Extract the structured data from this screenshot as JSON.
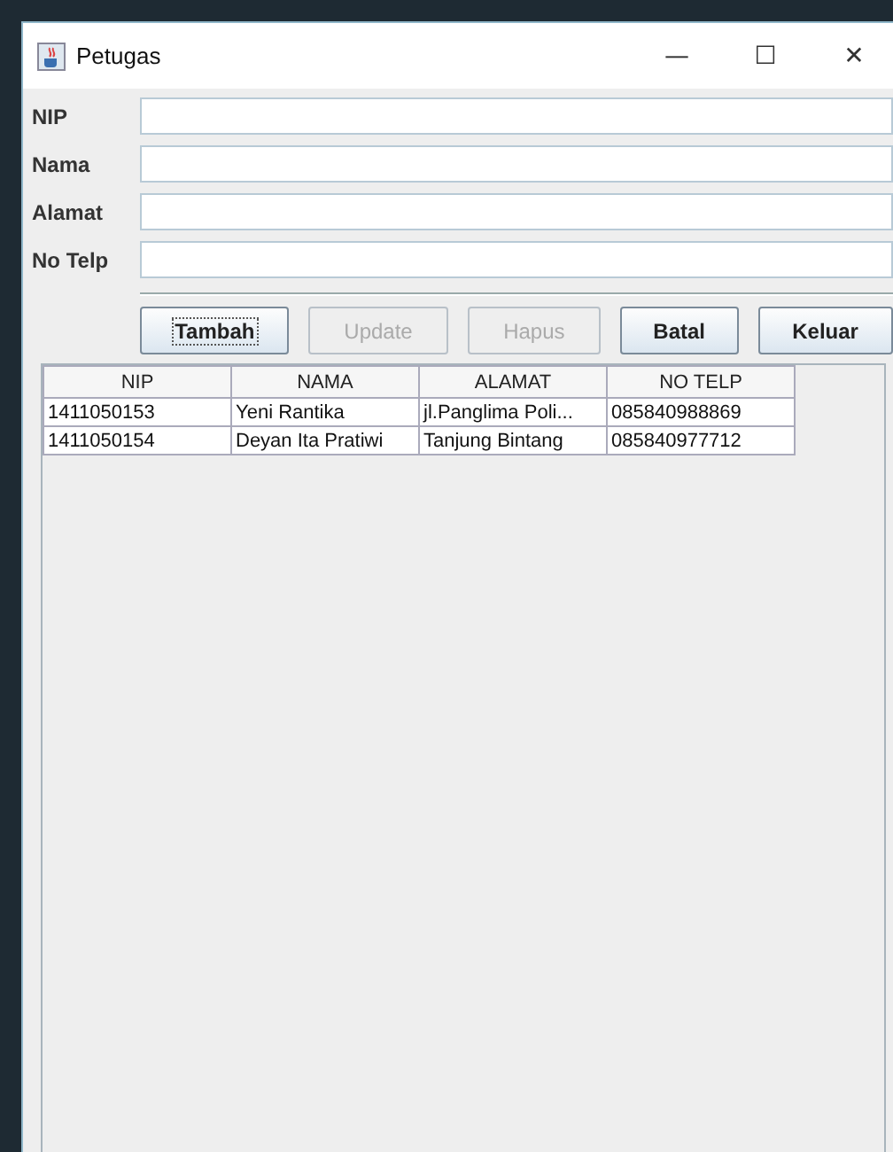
{
  "window": {
    "title": "Petugas",
    "controls": [
      "—",
      "☐",
      "✕"
    ]
  },
  "fields": [
    {
      "label": "NIP"
    },
    {
      "label": "Nama"
    },
    {
      "label": "Alamat"
    },
    {
      "label": "No Telp"
    }
  ],
  "buttons": [
    {
      "label": "Tambah",
      "disabled": false,
      "focused": true
    },
    {
      "label": "Update",
      "disabled": true,
      "focused": false
    },
    {
      "label": "Hapus",
      "disabled": true,
      "focused": false
    },
    {
      "label": "Batal",
      "disabled": false,
      "focused": false
    },
    {
      "label": "Keluar",
      "disabled": false,
      "focused": false
    }
  ],
  "table": {
    "columns": [
      "NIP",
      "NAMA",
      "ALAMAT",
      "NO TELP"
    ],
    "rows": [
      [
        "1411050153",
        "Yeni Rantika",
        "jl.Panglima Poli...",
        "085840988869"
      ],
      [
        "1411050154",
        "Deyan Ita Pratiwi",
        "Tanjung Bintang",
        "085840977712"
      ]
    ]
  }
}
